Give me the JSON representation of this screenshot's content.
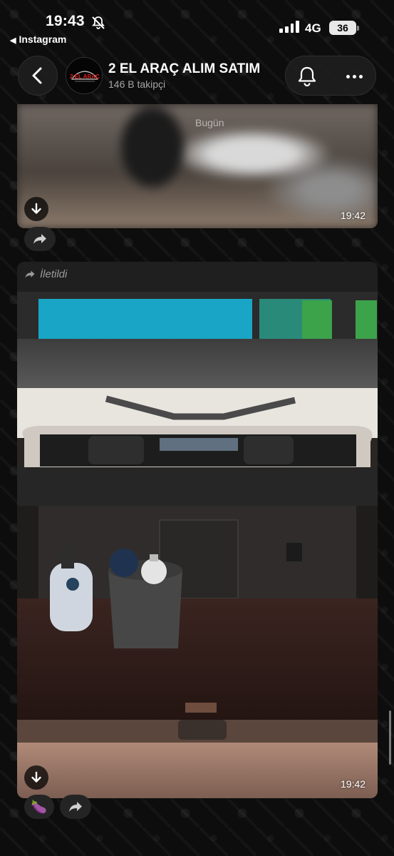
{
  "status_bar": {
    "time": "19:43",
    "back_app": "Instagram",
    "network": "4G",
    "battery": "36"
  },
  "header": {
    "channel_name": "2 EL ARAÇ ALIM SATIM",
    "followers": "146 B takipçi",
    "avatar_text": "2 EL ARAÇ"
  },
  "messages": [
    {
      "date_overlay": "Bugün",
      "time": "19:42"
    },
    {
      "forwarded_label": "İletildi",
      "time": "19:42",
      "reaction": "🍆"
    }
  ],
  "icons": {
    "back": "chevron-left-icon",
    "bell": "bell-icon",
    "more": "more-horizontal-icon",
    "download": "download-icon",
    "forward": "forward-icon",
    "muted": "bell-slash-icon"
  },
  "colors": {
    "background": "#0b0b0b",
    "bubble": "#1f1f1f",
    "muted_text": "#9b9b9b"
  }
}
